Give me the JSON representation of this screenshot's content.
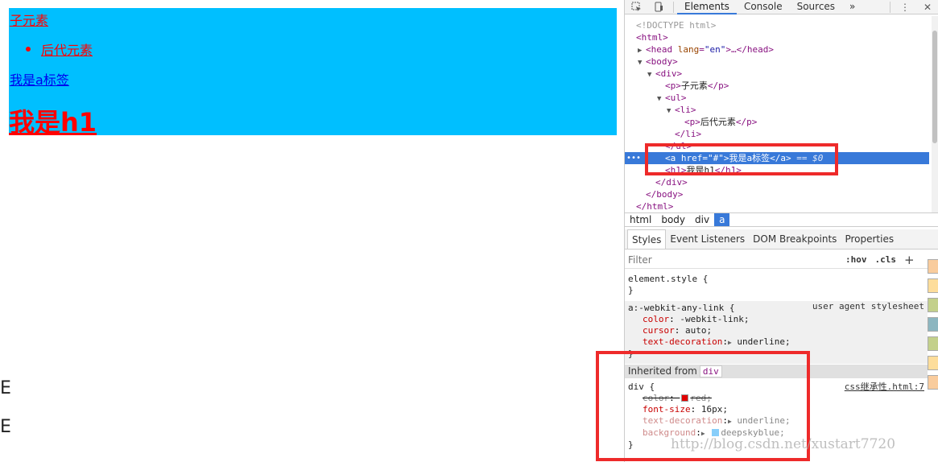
{
  "page": {
    "child_p": "子元素",
    "descendant_p": "后代元素",
    "a_tag": "我是a标签",
    "h1": "我是h1",
    "frag1": "E",
    "frag2": "E"
  },
  "devtools": {
    "tabs": [
      "Elements",
      "Console",
      "Sources"
    ],
    "more_tabs": "»",
    "menu": "⋮",
    "close": "✕",
    "dom": {
      "doctype": "<!DOCTYPE html>",
      "html_open": "<html>",
      "head_tag": "head",
      "head_attr": "lang",
      "head_val": "\"en\"",
      "head_rest": ">…</head>",
      "body_open": "<body>",
      "div_open": "<div>",
      "p_text": "子元素",
      "ul_open": "<ul>",
      "li_open": "<li>",
      "li_p_text": "后代元素",
      "li_close": "</li>",
      "ul_close": "</ul>",
      "a_href_val": "\"#\"",
      "a_text": "我是a标签",
      "a_eq": "== $0",
      "h1_text": "我是h1",
      "div_close": "</div>",
      "body_close": "</body>",
      "html_close": "</html>",
      "dots": "•••"
    },
    "breadcrumbs": [
      "html",
      "body",
      "div",
      "a"
    ],
    "subtabs": [
      "Styles",
      "Event Listeners",
      "DOM Breakpoints",
      "Properties"
    ],
    "filter": {
      "placeholder": "Filter",
      "hov": ":hov",
      "cls": ".cls",
      "plus": "+"
    },
    "styles": {
      "element_style": "element.style {",
      "close_brace": "}",
      "ua_selector": "a:-webkit-any-link {",
      "ua_source": "user agent stylesheet",
      "ua_props": [
        {
          "name": "color",
          "value": "-webkit-link;"
        },
        {
          "name": "cursor",
          "value": "auto;"
        },
        {
          "name": "text-decoration",
          "value": "underline;"
        }
      ],
      "inherited_label": "Inherited from",
      "inherited_tag": "div",
      "div_selector": "div {",
      "div_source": "css继承性.html:7",
      "div_props": [
        {
          "name": "color",
          "value": "red;"
        },
        {
          "name": "font-size",
          "value": "16px;"
        },
        {
          "name": "text-decoration",
          "value": "underline;"
        },
        {
          "name": "background",
          "value": "deepskyblue;"
        }
      ]
    }
  },
  "watermark": "http://blog.csdn.net/xustart7720",
  "colors": {
    "box_bg": "#00bfff",
    "red": "#ff0000",
    "link": "#0000ee",
    "selection": "#3879d9",
    "highlight_box": "#ee2a2a"
  }
}
